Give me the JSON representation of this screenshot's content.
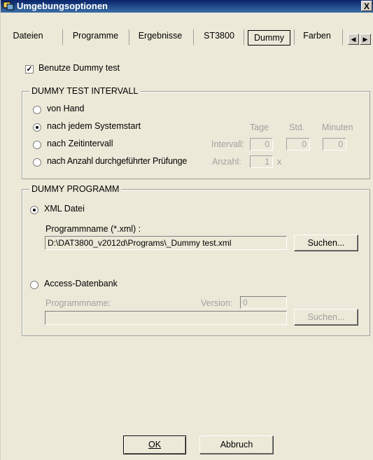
{
  "window": {
    "title": "Umgebungsoptionen",
    "close_label": "X"
  },
  "tabs": {
    "items": [
      "Dateien",
      "Programme",
      "Ergebnisse",
      "ST3800",
      "Dummy",
      "Farben"
    ],
    "selected": "Dummy",
    "scroll_left": "◀",
    "scroll_right": "▶"
  },
  "dummy": {
    "use_dummy_label": "Benutze Dummy test",
    "use_dummy_checked": true,
    "check_mark": "✓"
  },
  "interval_group": {
    "title": "DUMMY TEST INTERVALL",
    "options": [
      "von Hand",
      "nach jedem Systemstart",
      "nach Zeitintervall",
      "nach Anzahl durchgeführter Prüfunge"
    ],
    "selected_index": 1,
    "col_days": "Tage",
    "col_hours": "Std.",
    "col_minutes": "Minuten",
    "interval_label": "Intervall:",
    "interval_days": "0",
    "interval_hours": "0",
    "interval_minutes": "0",
    "count_label": "Anzahl:",
    "count_value": "1",
    "count_unit": "x"
  },
  "program_group": {
    "title": "DUMMY PROGRAMM",
    "xml_label": "XML Datei",
    "xml_selected": true,
    "program_name_label": "Programmname (*.xml) :",
    "program_path": "D:\\DAT3800_v2012d\\Programs\\_Dummy test.xml",
    "search_label": "Suchen...",
    "access_label": "Access-Datenbank",
    "access_name_label": "Programmname:",
    "version_label": "Version:",
    "version_value": "0",
    "access_name_value": "",
    "access_search_label": "Suchen..."
  },
  "footer": {
    "ok_label": "OK",
    "cancel_label": "Abbruch"
  }
}
